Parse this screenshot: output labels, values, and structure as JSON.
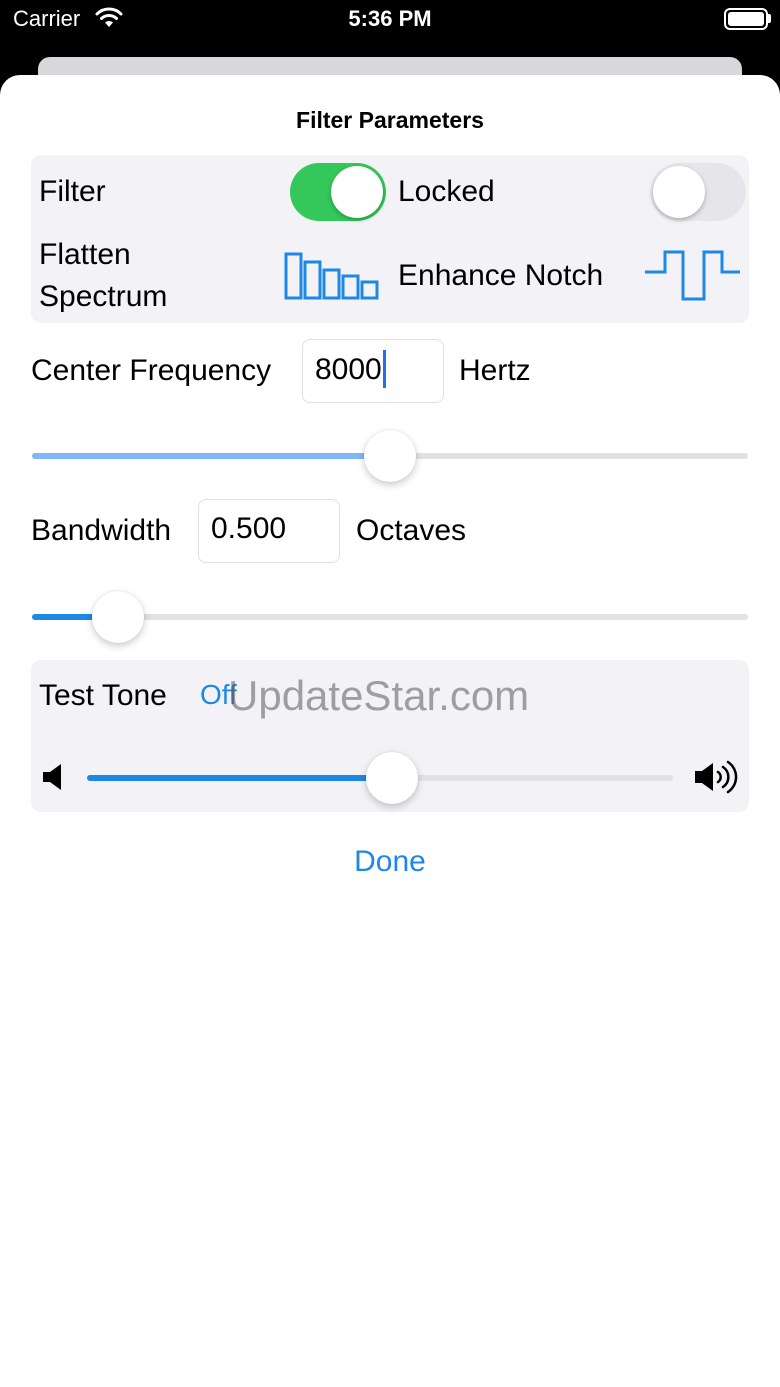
{
  "status_bar": {
    "carrier": "Carrier",
    "time": "5:36 PM",
    "wifi_icon": "wifi-icon",
    "battery_icon": "battery-icon"
  },
  "sheet": {
    "title": "Filter Parameters"
  },
  "filter": {
    "label": "Filter",
    "enabled": true
  },
  "locked": {
    "label": "Locked",
    "enabled": false
  },
  "flatten": {
    "label_line1": "Flatten",
    "label_line2": "Spectrum",
    "icon": "flatten-spectrum-icon"
  },
  "notch": {
    "label": "Enhance Notch",
    "icon": "notch-icon"
  },
  "center_frequency": {
    "label": "Center Frequency",
    "value": "8000",
    "unit": "Hertz",
    "slider_fraction": 0.5
  },
  "bandwidth": {
    "label": "Bandwidth",
    "value": "0.500",
    "unit": "Octaves",
    "slider_fraction": 0.12
  },
  "test_tone": {
    "label": "Test Tone",
    "state": "Off",
    "volume_fraction": 0.52
  },
  "watermark": "UpdateStar.com",
  "done_label": "Done",
  "colors": {
    "accent": "#1e88e5",
    "toggle_on": "#34c759",
    "slider_light": "#7fb8f7",
    "group_bg": "#f2f2f7"
  }
}
